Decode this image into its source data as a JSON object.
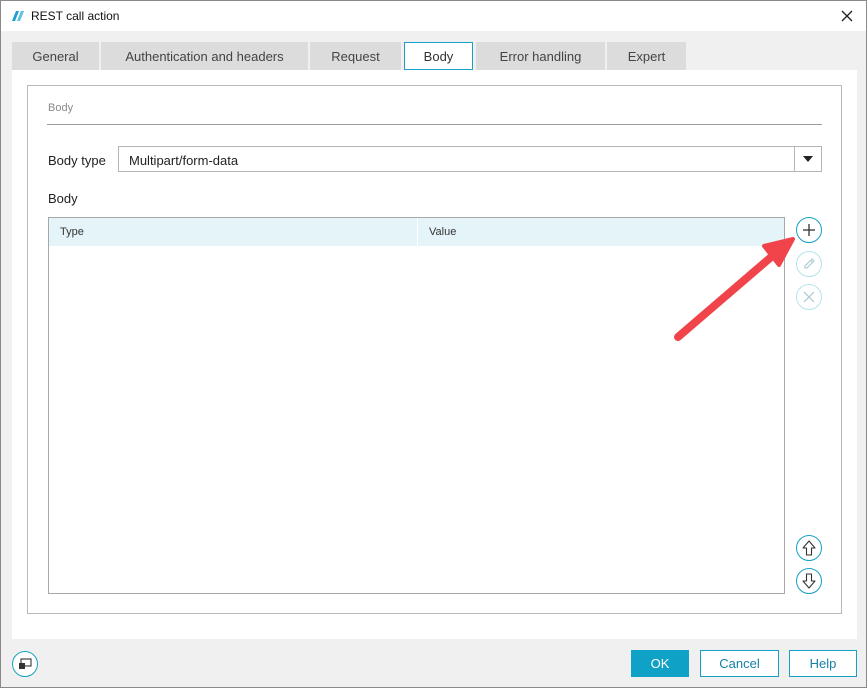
{
  "window": {
    "title": "REST call action"
  },
  "tabs": [
    {
      "label": "General"
    },
    {
      "label": "Authentication and headers"
    },
    {
      "label": "Request"
    },
    {
      "label": "Body",
      "active": true
    },
    {
      "label": "Error handling"
    },
    {
      "label": "Expert"
    }
  ],
  "section": {
    "title": "Body"
  },
  "body_type": {
    "label": "Body type",
    "value": "Multipart/form-data"
  },
  "body_table": {
    "label": "Body",
    "columns": [
      "Type",
      "Value"
    ],
    "rows": []
  },
  "side_buttons": [
    {
      "icon": "plus-icon",
      "enabled": true
    },
    {
      "icon": "pencil-icon",
      "enabled": false
    },
    {
      "icon": "close-x-icon",
      "enabled": false
    },
    {
      "icon": "arrow-up-icon",
      "enabled": true
    },
    {
      "icon": "arrow-down-icon",
      "enabled": true
    }
  ],
  "footer": {
    "ok_label": "OK",
    "cancel_label": "Cancel",
    "help_label": "Help"
  },
  "colors": {
    "accent": "#10a1c6",
    "annotation_arrow": "#f0444a",
    "header_bg": "#e4f4f9"
  }
}
